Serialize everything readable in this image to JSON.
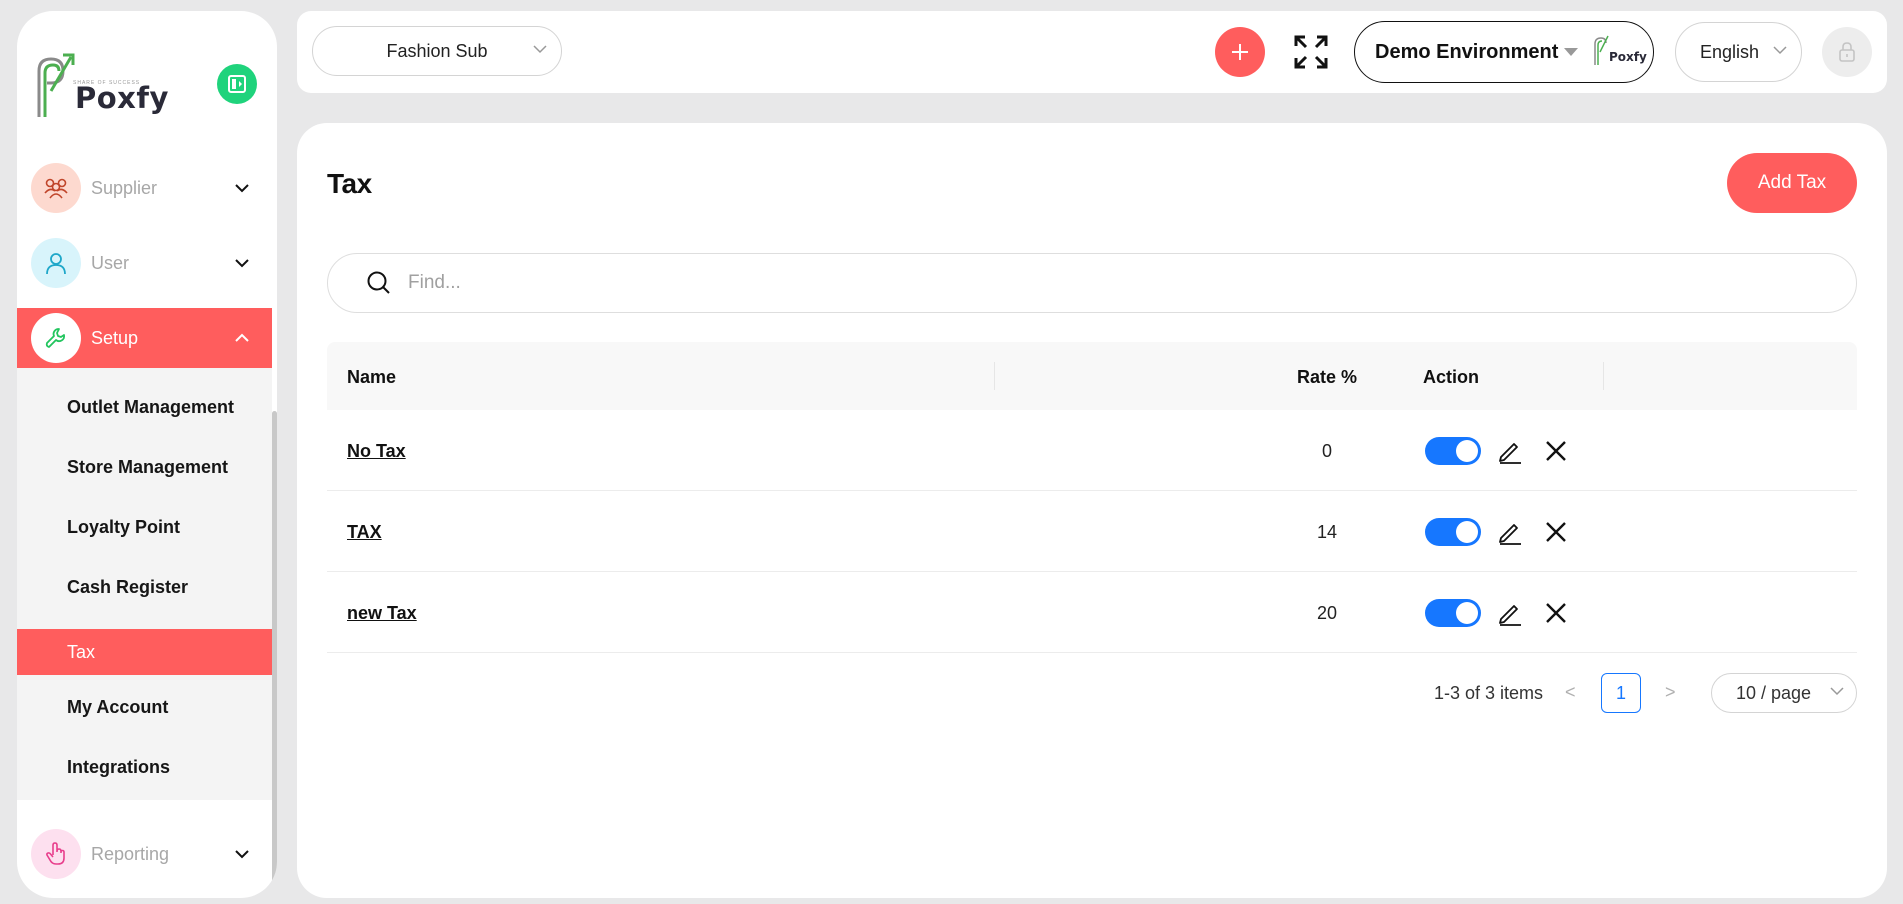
{
  "brand": {
    "name": "Poxfy",
    "tagline": "SHARE OF SUCCESS"
  },
  "sidebar": {
    "items": [
      {
        "label": "Supplier",
        "icon": "supplier-icon",
        "icon_bg": "#fdd9cf"
      },
      {
        "label": "User",
        "icon": "user-icon",
        "icon_bg": "#d8f4fb"
      },
      {
        "label": "Setup",
        "icon": "wrench-icon",
        "icon_bg": "#ffffff",
        "active": true
      },
      {
        "label": "Reporting",
        "icon": "hand-pointer-icon",
        "icon_bg": "#fde0ef"
      }
    ],
    "submenu": [
      {
        "label": "Outlet Management"
      },
      {
        "label": "Store Management"
      },
      {
        "label": "Loyalty Point"
      },
      {
        "label": "Cash Register"
      },
      {
        "label": "Tax",
        "active": true
      },
      {
        "label": "My Account"
      },
      {
        "label": "Integrations"
      }
    ]
  },
  "topbar": {
    "outlet": "Fashion Sub",
    "environment": "Demo Environment",
    "environment_logo": "Poxfy",
    "language": "English"
  },
  "page": {
    "title": "Tax",
    "add_button": "Add Tax",
    "search_placeholder": "Find..."
  },
  "table": {
    "columns": [
      "Name",
      "Rate %",
      "Action"
    ],
    "rows": [
      {
        "name": "No Tax",
        "rate": "0",
        "enabled": true
      },
      {
        "name": "TAX",
        "rate": "14",
        "enabled": true
      },
      {
        "name": "new Tax",
        "rate": "20",
        "enabled": true
      }
    ]
  },
  "pagination": {
    "total_text": "1-3 of 3 items",
    "prev": "<",
    "current_page": "1",
    "next": ">",
    "page_size": "10 / page"
  },
  "colors": {
    "accent": "#ff5d5d",
    "primary_blue": "#1677ff",
    "brand_green": "#1fd37c"
  }
}
